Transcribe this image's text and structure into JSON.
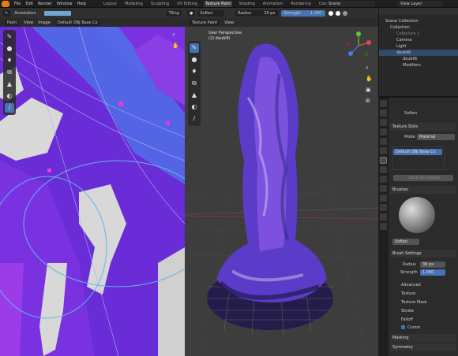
{
  "menu": [
    "File",
    "Edit",
    "Render",
    "Window",
    "Help"
  ],
  "workspaces": [
    "Layout",
    "Modeling",
    "Sculpting",
    "UV Editing",
    "Texture Paint",
    "Shading",
    "Animation",
    "Rendering",
    "Compositing"
  ],
  "active_workspace": "Texture Paint",
  "scene_name": "Scene",
  "view_layer": "View Layer",
  "image_editor": {
    "mode": "Paint",
    "tool_label": "Annotation",
    "tiling": "Tiling",
    "menus": [
      "View",
      "Image"
    ],
    "image_name": "Default OBJ Base Co"
  },
  "viewport": {
    "mode": "Texture Paint",
    "view_menu": "View",
    "brush": "Soften",
    "radius_label": "Radius",
    "radius_value": "39 px",
    "strength_label": "Strength",
    "strength_value": "1.000",
    "perspective": "User Perspective",
    "object": "(2) doubl6i"
  },
  "outliner": {
    "title": "Scene Collection",
    "rows": [
      "Collection",
      "Collection 2",
      "Camera",
      "Light",
      "doubl6i",
      "doubl6i",
      "Modifiers"
    ]
  },
  "properties": {
    "brush_name": "Soften",
    "texture_slots": "Texture Slots",
    "mode_label": "Mode",
    "mode_value": "Material",
    "slot_item": "Default OBJ Base Co",
    "save_all": "Save All Images",
    "brushes": "Brushes",
    "brush_field": "Soften",
    "brush_settings": "Brush Settings",
    "radius_label": "Radius",
    "radius_value": "39 px",
    "strength_label": "Strength",
    "strength_value": "1.000",
    "subsections": [
      "Advanced",
      "Texture",
      "Texture Mask",
      "Stroke",
      "Falloff",
      "Cursor"
    ],
    "masking": "Masking",
    "symmetry": "Symmetry"
  },
  "colors": {
    "accent": "#4772b3",
    "logo": "#e87d0d",
    "texture_purple": "#6e2cd9",
    "texture_blue": "#3d6ef0",
    "texture_magenta": "#c23be6"
  }
}
